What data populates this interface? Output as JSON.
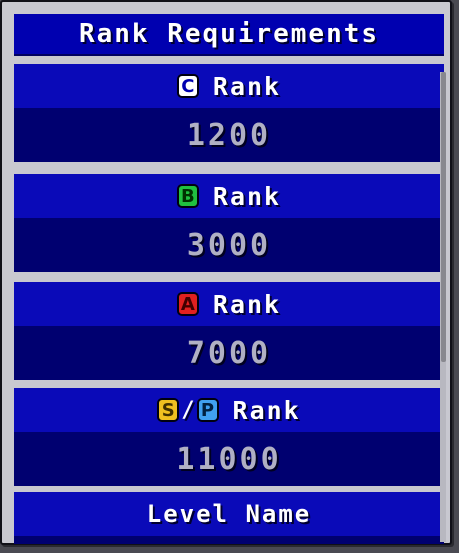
{
  "panel": {
    "title": "Rank Requirements"
  },
  "ranks": [
    {
      "badges": [
        {
          "letter": "C",
          "color": "#ffffff",
          "text_color": "#0000b0"
        }
      ],
      "label": "Rank",
      "score": "1200"
    },
    {
      "badges": [
        {
          "letter": "B",
          "color": "#20c040",
          "text_color": "#003000"
        }
      ],
      "label": "Rank",
      "score": "3000"
    },
    {
      "badges": [
        {
          "letter": "A",
          "color": "#e02020",
          "text_color": "#400000"
        }
      ],
      "label": "Rank",
      "score": "7000"
    },
    {
      "badges": [
        {
          "letter": "S",
          "color": "#f0c020",
          "text_color": "#403000"
        },
        {
          "letter": "P",
          "color": "#40a0f0",
          "text_color": "#002040"
        }
      ],
      "separator": "/",
      "label": "Rank",
      "score": "11000"
    }
  ],
  "footer": {
    "label": "Level Name"
  },
  "colors": {
    "header_blue": "#0a0ab8",
    "value_navy": "#000070",
    "panel_gray": "#c8c8d0"
  }
}
